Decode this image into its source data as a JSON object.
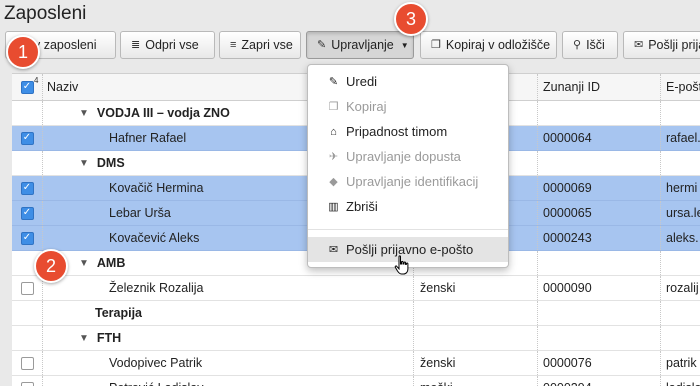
{
  "page": {
    "title": "Zaposleni"
  },
  "toolbar": {
    "add_label": "y zaposleni",
    "open_all_label": "Odpri vse",
    "close_all_label": "Zapri vse",
    "manage_label": "Upravljanje",
    "copy_clipboard_label": "Kopiraj v odložišče",
    "search_label": "Išči",
    "send_label": "Pošlji prija"
  },
  "table": {
    "header": {
      "count": "4",
      "name": "Naziv",
      "external_id": "Zunanji ID",
      "email": "E-pošt"
    },
    "rows": [
      {
        "type": "group",
        "level": 1,
        "name": "VODJA III – vodja ZNO",
        "gender": "",
        "external_id": "",
        "email": "",
        "checked": false,
        "selected": false
      },
      {
        "type": "person",
        "level": 1,
        "name": "Hafner Rafael",
        "gender": "",
        "external_id": "0000064",
        "email": "rafael.",
        "checked": true,
        "selected": true
      },
      {
        "type": "group",
        "level": 1,
        "name": "DMS",
        "gender": "",
        "external_id": "",
        "email": "",
        "checked": false,
        "selected": false
      },
      {
        "type": "person",
        "level": 1,
        "name": "Kovačič Hermina",
        "gender": "",
        "external_id": "0000069",
        "email": "hermi",
        "checked": true,
        "selected": true
      },
      {
        "type": "person",
        "level": 1,
        "name": "Lebar Urša",
        "gender": "",
        "external_id": "0000065",
        "email": "ursa.le",
        "checked": true,
        "selected": true
      },
      {
        "type": "person",
        "level": 1,
        "name": "Kovačević Aleks",
        "gender": "",
        "external_id": "0000243",
        "email": "aleks.",
        "checked": true,
        "selected": true
      },
      {
        "type": "group",
        "level": 0,
        "name": "AMB",
        "gender": "",
        "external_id": "",
        "email": "",
        "checked": false,
        "selected": false
      },
      {
        "type": "person",
        "level": 1,
        "name": "Železnik Rozalija",
        "gender": "ženski",
        "external_id": "0000090",
        "email": "rozalij",
        "checked": false,
        "selected": false
      },
      {
        "type": "group-plain",
        "level": 0,
        "name": "Terapija",
        "gender": "",
        "external_id": "",
        "email": "",
        "checked": false,
        "selected": false
      },
      {
        "type": "group",
        "level": 0,
        "name": "FTH",
        "gender": "",
        "external_id": "",
        "email": "",
        "checked": false,
        "selected": false
      },
      {
        "type": "person",
        "level": 1,
        "name": "Vodopivec Patrik",
        "gender": "ženski",
        "external_id": "0000076",
        "email": "patrik",
        "checked": false,
        "selected": false
      },
      {
        "type": "person",
        "level": 1,
        "name": "Petrović Ladislav",
        "gender": "moški",
        "external_id": "0000294",
        "email": "ladisla",
        "checked": false,
        "selected": false
      }
    ]
  },
  "dropdown": {
    "items": [
      {
        "label": "Uredi",
        "icon": "pencil-icon",
        "disabled": false
      },
      {
        "label": "Kopiraj",
        "icon": "copy-icon",
        "disabled": true
      },
      {
        "label": "Pripadnost timom",
        "icon": "home-icon",
        "disabled": false
      },
      {
        "label": "Upravljanje dopusta",
        "icon": "plane-icon",
        "disabled": true
      },
      {
        "label": "Upravljanje identifikacij",
        "icon": "tag-icon",
        "disabled": true
      },
      {
        "label": "Zbriši",
        "icon": "trash-icon",
        "disabled": false
      },
      {
        "label": "Pošlji prijavno e-pošto",
        "icon": "envelope-icon",
        "disabled": false
      }
    ]
  },
  "badges": [
    "1",
    "2",
    "3"
  ],
  "colors": {
    "selected_row": "#a7c5f0",
    "badge": "#e84c30",
    "checkbox_checked": "#3e8ee6"
  }
}
